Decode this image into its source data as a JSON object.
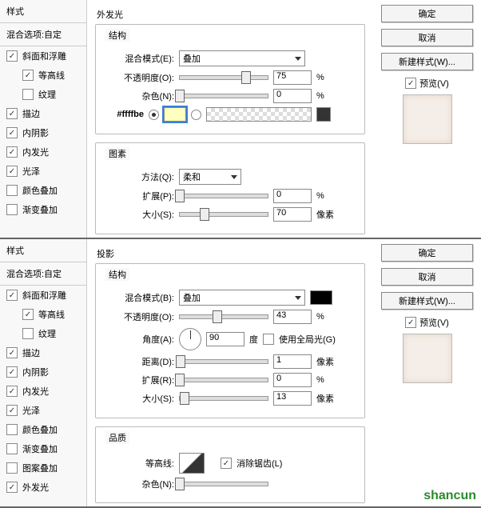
{
  "styles": {
    "header": "样式",
    "options": "混合选项:自定",
    "items": [
      {
        "label": "斜面和浮雕",
        "on": true
      },
      {
        "label": "等高线",
        "on": true,
        "indent": true
      },
      {
        "label": "纹理",
        "on": false,
        "indent": true
      },
      {
        "label": "描边",
        "on": true
      },
      {
        "label": "内阴影",
        "on": true
      },
      {
        "label": "内发光",
        "on": true
      },
      {
        "label": "光泽",
        "on": true
      },
      {
        "label": "颜色叠加",
        "on": false
      },
      {
        "label": "渐变叠加",
        "on": false
      }
    ],
    "items2": [
      {
        "label": "斜面和浮雕",
        "on": true
      },
      {
        "label": "等高线",
        "on": true,
        "indent": true
      },
      {
        "label": "纹理",
        "on": false,
        "indent": true
      },
      {
        "label": "描边",
        "on": true
      },
      {
        "label": "内阴影",
        "on": true
      },
      {
        "label": "内发光",
        "on": true
      },
      {
        "label": "光泽",
        "on": true
      },
      {
        "label": "颜色叠加",
        "on": false
      },
      {
        "label": "渐变叠加",
        "on": false
      },
      {
        "label": "图案叠加",
        "on": false
      },
      {
        "label": "外发光",
        "on": true
      }
    ]
  },
  "panel1": {
    "title": "外发光",
    "struct": "结构",
    "blend_lbl": "混合模式(E):",
    "blend_val": "叠加",
    "opacity_lbl": "不透明度(O):",
    "opacity_val": "75",
    "opacity_unit": "%",
    "noise_lbl": "杂色(N):",
    "noise_val": "0",
    "noise_unit": "%",
    "hex": "#ffffbe",
    "elements": "图素",
    "method_lbl": "方法(Q):",
    "method_val": "柔和",
    "spread_lbl": "扩展(P):",
    "spread_val": "0",
    "spread_unit": "%",
    "size_lbl": "大小(S):",
    "size_val": "70",
    "size_unit": "像素"
  },
  "panel2": {
    "title": "投影",
    "struct": "结构",
    "blend_lbl": "混合模式(B):",
    "blend_val": "叠加",
    "opacity_lbl": "不透明度(O):",
    "opacity_val": "43",
    "opacity_unit": "%",
    "angle_lbl": "角度(A):",
    "angle_val": "90",
    "angle_unit": "度",
    "global_lbl": "使用全局光(G)",
    "global_on": false,
    "dist_lbl": "距离(D):",
    "dist_val": "1",
    "dist_unit": "像素",
    "spread_lbl": "扩展(R):",
    "spread_val": "0",
    "spread_unit": "%",
    "size_lbl": "大小(S):",
    "size_val": "13",
    "size_unit": "像素",
    "quality": "品质",
    "contour_lbl": "等高线:",
    "aa_lbl": "消除锯齿(L)",
    "aa_on": true,
    "noise_lbl": "杂色(N):"
  },
  "right": {
    "ok": "确定",
    "cancel": "取消",
    "newstyle": "新建样式(W)...",
    "preview": "预览(V)"
  },
  "wm": "shancun"
}
